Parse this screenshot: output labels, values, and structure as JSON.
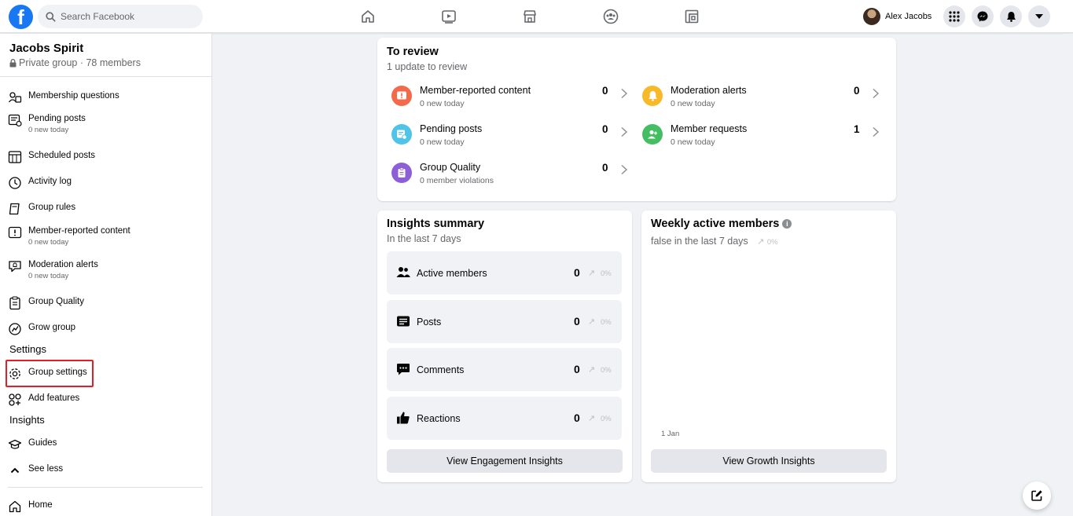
{
  "topbar": {
    "search_placeholder": "Search Facebook",
    "profile_name": "Alex Jacobs"
  },
  "group": {
    "name": "Jacobs Spirit",
    "privacy": "Private group",
    "separator": " · ",
    "members": "78 members"
  },
  "sidebar": {
    "items": [
      {
        "label": "Membership questions",
        "icon": "membership-questions-icon"
      },
      {
        "label": "Pending posts",
        "sub": "0 new today",
        "icon": "pending-posts-icon"
      },
      {
        "label": "Scheduled posts",
        "icon": "scheduled-posts-icon"
      },
      {
        "label": "Activity log",
        "icon": "clock-icon"
      },
      {
        "label": "Group rules",
        "icon": "rules-icon"
      },
      {
        "label": "Member-reported content",
        "sub": "0 new today",
        "icon": "report-icon"
      },
      {
        "label": "Moderation alerts",
        "sub": "0 new today",
        "icon": "alert-icon"
      },
      {
        "label": "Group Quality",
        "icon": "clipboard-icon"
      },
      {
        "label": "Grow group",
        "icon": "grow-icon"
      }
    ],
    "settings_heading": "Settings",
    "settings_items": [
      {
        "label": "Group settings",
        "icon": "gear-icon"
      },
      {
        "label": "Add features",
        "icon": "features-icon"
      }
    ],
    "insights_heading": "Insights",
    "insights_items": [
      {
        "label": "Guides",
        "icon": "guides-icon"
      },
      {
        "label": "See less",
        "icon": "chevron-up-icon"
      }
    ],
    "home_label": "Home"
  },
  "to_review": {
    "title": "To review",
    "subtitle": "1 update to review",
    "items": [
      {
        "label": "Member-reported content",
        "sub": "0 new today",
        "count": "0",
        "color": "#f3694a"
      },
      {
        "label": "Moderation alerts",
        "sub": "0 new today",
        "count": "0",
        "color": "#f7b928"
      },
      {
        "label": "Pending posts",
        "sub": "0 new today",
        "count": "0",
        "color": "#4fc3e8"
      },
      {
        "label": "Member requests",
        "sub": "0 new today",
        "count": "1",
        "color": "#45bd62"
      },
      {
        "label": "Group Quality",
        "sub": "0 member violations",
        "count": "0",
        "color": "#8c5fd6"
      }
    ]
  },
  "insights_summary": {
    "title": "Insights summary",
    "subtitle": "In the last 7 days",
    "rows": [
      {
        "label": "Active members",
        "value": "0",
        "pct": "0%"
      },
      {
        "label": "Posts",
        "value": "0",
        "pct": "0%"
      },
      {
        "label": "Comments",
        "value": "0",
        "pct": "0%"
      },
      {
        "label": "Reactions",
        "value": "0",
        "pct": "0%"
      }
    ],
    "button": "View Engagement Insights"
  },
  "weekly_active": {
    "title": "Weekly active members",
    "info": "i",
    "subtitle": "false in the last 7 days",
    "pct": "0%",
    "axis_label": "1 Jan",
    "button": "View Growth Insights"
  },
  "colors": {
    "brand": "#1877f2",
    "highlight": "#e41e26"
  }
}
